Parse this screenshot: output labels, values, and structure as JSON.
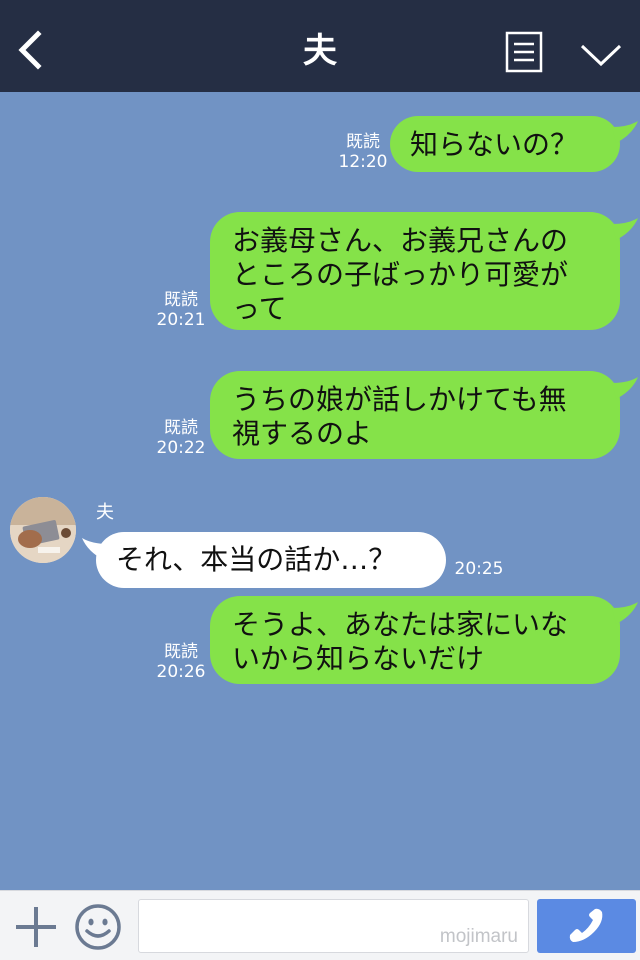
{
  "header": {
    "title": "夫",
    "back_icon": "back-icon",
    "menu_icon": "note-icon",
    "more_icon": "chevron-down-icon"
  },
  "messages": [
    {
      "sender": "me",
      "read": "既読",
      "time": "12:20",
      "lines": [
        "知らないの？"
      ]
    },
    {
      "sender": "me",
      "read": "既読",
      "time": "20:21",
      "lines": [
        "お義母さん、お義兄さんの",
        "ところの子ばっかり可愛が",
        "って"
      ]
    },
    {
      "sender": "me",
      "read": "既読",
      "time": "20:22",
      "lines": [
        "うちの娘が話しかけても無",
        "視するのよ"
      ]
    },
    {
      "sender": "夫",
      "name": "夫",
      "time": "20:25",
      "lines": [
        "それ、本当の話か…？"
      ]
    },
    {
      "sender": "me",
      "read": "既読",
      "time": "20:26",
      "lines": [
        "そうよ、あなたは家にいな",
        "いから知らないだけ"
      ]
    }
  ],
  "input_bar": {
    "plus_icon": "plus-icon",
    "emoji_icon": "smiley-icon",
    "input_value": "",
    "watermark": "mojimaru",
    "call_icon": "phone-icon"
  },
  "colors": {
    "header_bg": "#252e44",
    "chat_bg": "#7193c4",
    "sent_bubble": "#85e249",
    "received_bubble": "#ffffff",
    "call_button": "#5b8ae3"
  }
}
